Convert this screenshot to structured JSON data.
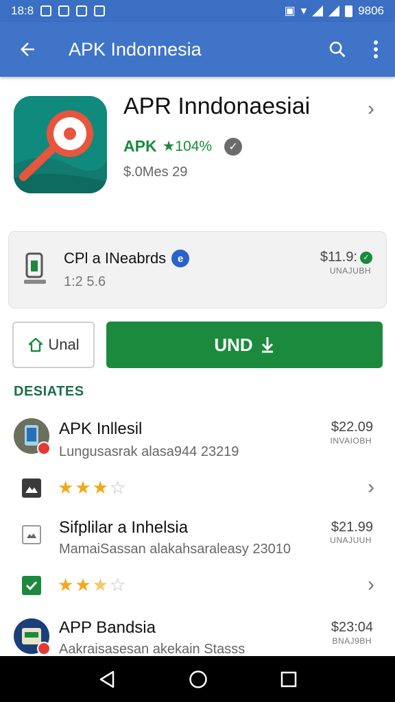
{
  "status_bar": {
    "time": "18:8",
    "battery_text": "9806"
  },
  "app_bar": {
    "title": "APK Indonnesia",
    "back_icon": "arrow-left-icon",
    "search_icon": "search-icon",
    "more_icon": "more-vert-icon"
  },
  "app": {
    "name": "APR Inndonaesiai",
    "developer": "APK",
    "rating_text": "★104%",
    "price_line": "$.0Mes 29",
    "icon_color": "#0f8a7d"
  },
  "info_card": {
    "title": "CPl a INeabrds",
    "subtitle": "1:2 5.6",
    "price": "$11.9:",
    "tag": "UNAJUBH",
    "badge": "e"
  },
  "buttons": {
    "secondary_label": "Unal",
    "primary_label": "UND"
  },
  "section_title": "DESIATES",
  "items": [
    {
      "title": "APK Inllesil",
      "subtitle": "Lungusasrak alasa944 23219",
      "price": "$22.09",
      "tag": "INVAIOBH"
    },
    {
      "title": "Sifplilar a Inhelsia",
      "subtitle": "MamaiSassan alakahsaraleasy 23010",
      "price": "$21.99",
      "tag": "UNAJUUH"
    },
    {
      "title": "APP Bandsia",
      "subtitle": "Aakraisasesan akekain Stasss",
      "price": "$23:04",
      "tag": "BNAJ9BH"
    }
  ],
  "rating_rows": [
    {
      "filled": 3,
      "half": 0,
      "total": 4
    },
    {
      "filled": 2,
      "half": 1,
      "total": 4
    }
  ],
  "colors": {
    "primary": "#3f74c9",
    "accent_green": "#1b8a3d",
    "star": "#f2a818"
  }
}
